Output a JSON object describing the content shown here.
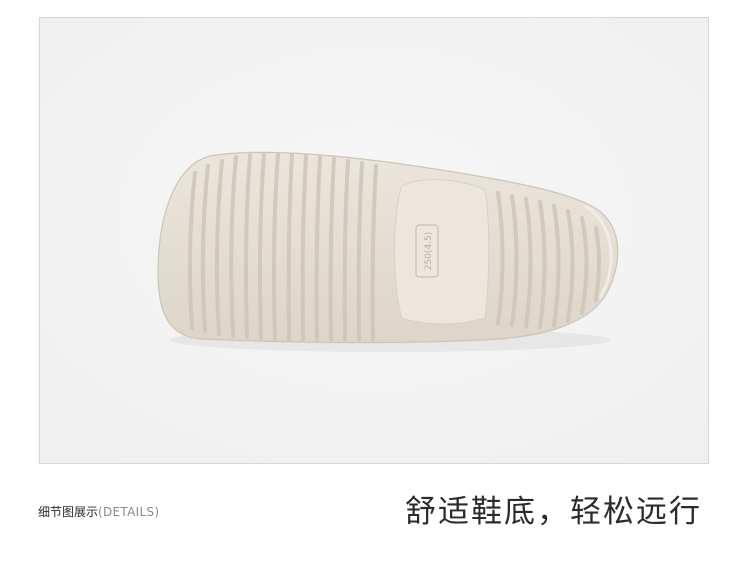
{
  "image": {
    "subject": "shoe-sole-bottom-view",
    "sole_size_mark": "250(4.5)",
    "colors": {
      "sole": "#e7e0d6",
      "sole_shade": "#d3cabd",
      "background": "#f3f3f3",
      "frame_border": "#d7d7d7"
    }
  },
  "caption": {
    "label_cn": "细节图展示",
    "label_en": "(DETAILS)",
    "headline": "舒适鞋底，轻松远行"
  }
}
